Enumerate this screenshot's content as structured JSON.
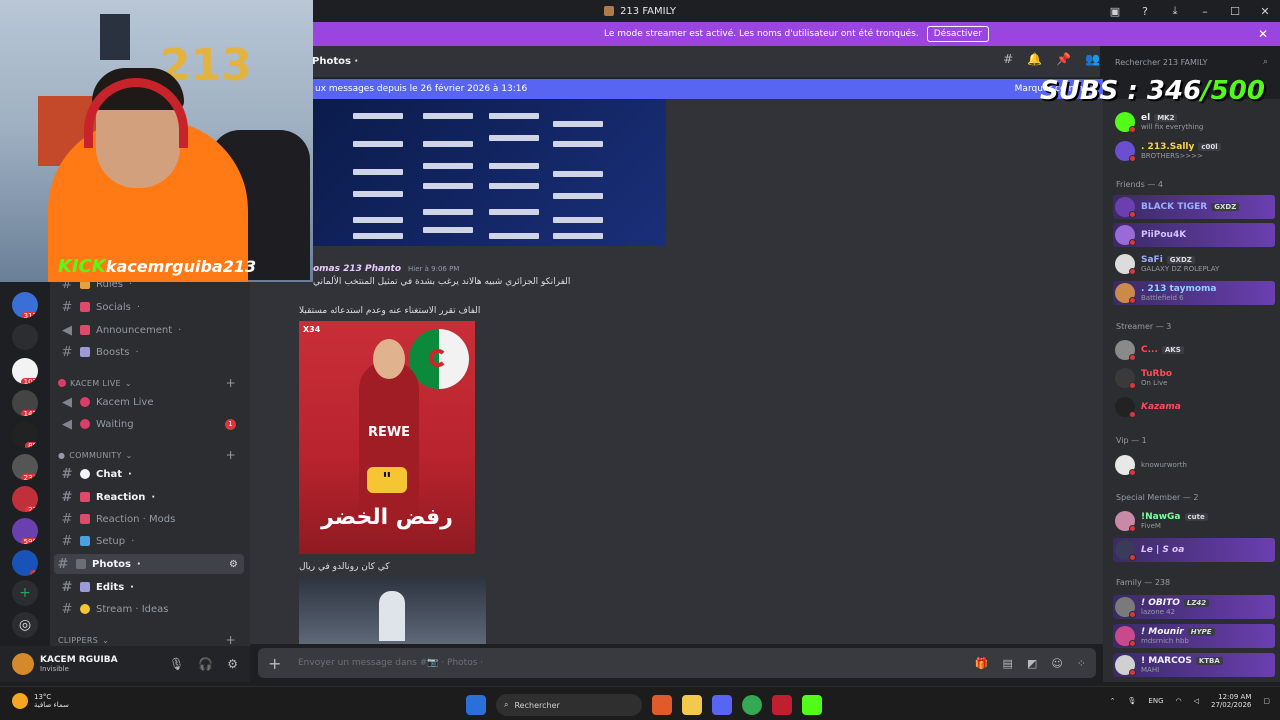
{
  "window": {
    "title": "213 FAMILY"
  },
  "banner": {
    "text": "Le mode streamer est activé. Les noms d'utilisateur ont été tronqués.",
    "button": "Désactiver"
  },
  "header": {
    "channel": "Photos",
    "search_placeholder": "Rechercher 213 FAMILY"
  },
  "newbar": {
    "text": "ux messages depuis le 26 février 2026 à 13:16",
    "mark": "Marquer comm"
  },
  "rail": {
    "badges": [
      "312",
      "102",
      "142",
      "89",
      "234",
      "23",
      "590",
      "4"
    ]
  },
  "channels": {
    "items_top": [
      {
        "label": "Rules"
      },
      {
        "label": "Socials"
      },
      {
        "label": "Announcement"
      },
      {
        "label": "Boosts"
      }
    ],
    "cat_live": "KACEM LIVE",
    "live_items": [
      {
        "label": "Kacem Live"
      },
      {
        "label": "Waiting",
        "unread": "1"
      }
    ],
    "cat_community": "COMMUNITY",
    "community_items": [
      {
        "label": "Chat"
      },
      {
        "label": "Reaction"
      },
      {
        "label": "Reaction · Mods"
      },
      {
        "label": "Setup"
      },
      {
        "label": "Photos"
      },
      {
        "label": "Edits"
      },
      {
        "label": "Stream · Ideas"
      }
    ],
    "cat_clippers": "CLIPPERS"
  },
  "user": {
    "name": "KACEM RGUIBA",
    "status": "Invisible"
  },
  "messages": {
    "author": "omas 213 Phanto",
    "time": "Hier à 9:06 PM",
    "line1": "الفرانكو الجزائري شبيه هالاند يرغب بشدة في تمثيل المنتخب الألماني",
    "line2": "الفاف تقرر الاستغناء عنه وعدم استدعائه مستقبلا",
    "img_tag": "X34",
    "img_rewe": "REWE",
    "img_quote": "\"",
    "img_arabic": "رفض الخضر",
    "line3": "كي كان رونالدو في ريال"
  },
  "composer": {
    "placeholder": "Envoyer un message dans #📷 · Photos ·"
  },
  "members": {
    "top": [
      {
        "name": "el",
        "tag": "MK2",
        "sub": "will fix everything"
      },
      {
        "name": ". 213.Sally",
        "tag": "c00l",
        "sub": "BROTHERS>>>>"
      }
    ],
    "friends_cat": "Friends — 4",
    "friends": [
      {
        "name": "BLACK TIGER",
        "tag": "GXDZ",
        "sub": ""
      },
      {
        "name": "PiiPou4K",
        "tag": "",
        "sub": ""
      },
      {
        "name": "SaFi",
        "tag": "GXDZ",
        "sub": "GALAXY DZ ROLEPLAY"
      },
      {
        "name": ". 213 taymoma",
        "tag": "",
        "sub": "Battlefield 6"
      }
    ],
    "streamer_cat": "Streamer — 3",
    "streamers": [
      {
        "name": "C...",
        "tag": "AKS",
        "sub": ""
      },
      {
        "name": "TuRbo",
        "tag": "",
        "sub": "On Live"
      },
      {
        "name": "Kazama",
        "tag": "",
        "sub": ""
      }
    ],
    "vip_cat": "Vip — 1",
    "vips": [
      {
        "name": "",
        "tag": "",
        "sub": "knowurworth"
      }
    ],
    "special_cat": "Special Member — 2",
    "specials": [
      {
        "name": "!NawGa",
        "tag": "cute",
        "sub": "FiveM"
      },
      {
        "name": "Le | S oa",
        "tag": "",
        "sub": ""
      }
    ],
    "family_cat": "Family — 238",
    "family": [
      {
        "name": "! OBITO",
        "tag": "LZ42",
        "sub": "lazone 42"
      },
      {
        "name": "! Mounir",
        "tag": "HYPE",
        "sub": "mdsrnich hbb"
      },
      {
        "name": "! MARCOS",
        "tag": "KTBA",
        "sub": "MAHI"
      }
    ]
  },
  "overlay": {
    "kick_brand": "KICK",
    "kick_user": "kacemrguiba213",
    "balloon": "213",
    "subs_label": "SUBS : 346",
    "subs_goal": "/500"
  },
  "taskbar": {
    "temp": "13°C",
    "weather": "سماء صافية",
    "search": "Rechercher",
    "lang": "ENG",
    "time": "12:09 AM",
    "date": "27/02/2026"
  },
  "colors": {
    "accent": "#5865f2",
    "banner": "#9b45e0",
    "kick": "#53fc18"
  }
}
